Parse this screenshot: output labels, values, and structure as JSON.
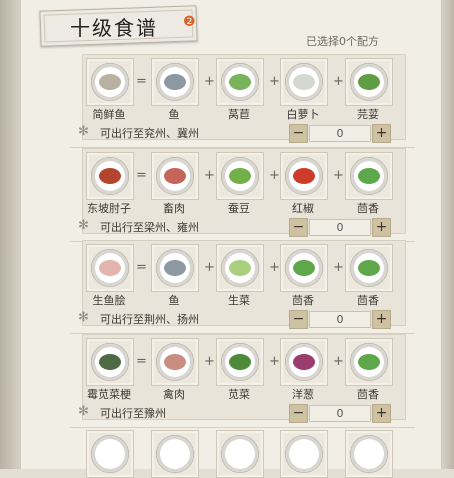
{
  "header": {
    "title": "十级食谱",
    "selected_text": "已选择0个配方"
  },
  "recipes": [
    {
      "dish": {
        "name": "简鲜鱼",
        "icon": "fish-stew-dish",
        "color": "#b8b0a0"
      },
      "ingredients": [
        {
          "name": "鱼",
          "icon": "fish-icon",
          "color": "#8d99a2"
        },
        {
          "name": "莴苣",
          "icon": "lettuce-icon",
          "color": "#79b35b"
        },
        {
          "name": "白萝卜",
          "icon": "radish-icon",
          "color": "#d4d8d0"
        },
        {
          "name": "芫荽",
          "icon": "cilantro-icon",
          "color": "#5f9d45"
        }
      ],
      "travel": "可出行至兖州、冀州",
      "qty": "0"
    },
    {
      "dish": {
        "name": "东坡肘子",
        "icon": "pork-knuckle-dish",
        "color": "#b24430"
      },
      "ingredients": [
        {
          "name": "畜肉",
          "icon": "meat-icon",
          "color": "#c5645a"
        },
        {
          "name": "蚕豆",
          "icon": "broad-bean-icon",
          "color": "#72b04a"
        },
        {
          "name": "红椒",
          "icon": "red-pepper-icon",
          "color": "#cf3b2a"
        },
        {
          "name": "茴香",
          "icon": "fennel-icon",
          "color": "#5ea74a"
        }
      ],
      "travel": "可出行至梁州、雍州",
      "qty": "0"
    },
    {
      "dish": {
        "name": "生鱼脍",
        "icon": "sashimi-dish",
        "color": "#e4b5ad"
      },
      "ingredients": [
        {
          "name": "鱼",
          "icon": "fish-icon",
          "color": "#8d99a2"
        },
        {
          "name": "生菜",
          "icon": "lettuce-icon",
          "color": "#a9cf7e"
        },
        {
          "name": "茴香",
          "icon": "fennel-icon",
          "color": "#5ea74a"
        },
        {
          "name": "茴香",
          "icon": "fennel-icon",
          "color": "#5ea74a"
        }
      ],
      "travel": "可出行至荆州、扬州",
      "qty": "0"
    },
    {
      "dish": {
        "name": "霉苋菜梗",
        "icon": "amaranth-dish",
        "color": "#4d6a44"
      },
      "ingredients": [
        {
          "name": "禽肉",
          "icon": "poultry-icon",
          "color": "#c98d82"
        },
        {
          "name": "苋菜",
          "icon": "amaranth-icon",
          "color": "#4d8a3a"
        },
        {
          "name": "洋葱",
          "icon": "onion-icon",
          "color": "#9b3b6e"
        },
        {
          "name": "茴香",
          "icon": "fennel-icon",
          "color": "#5ea74a"
        }
      ],
      "travel": "可出行至豫州",
      "qty": "0"
    }
  ]
}
